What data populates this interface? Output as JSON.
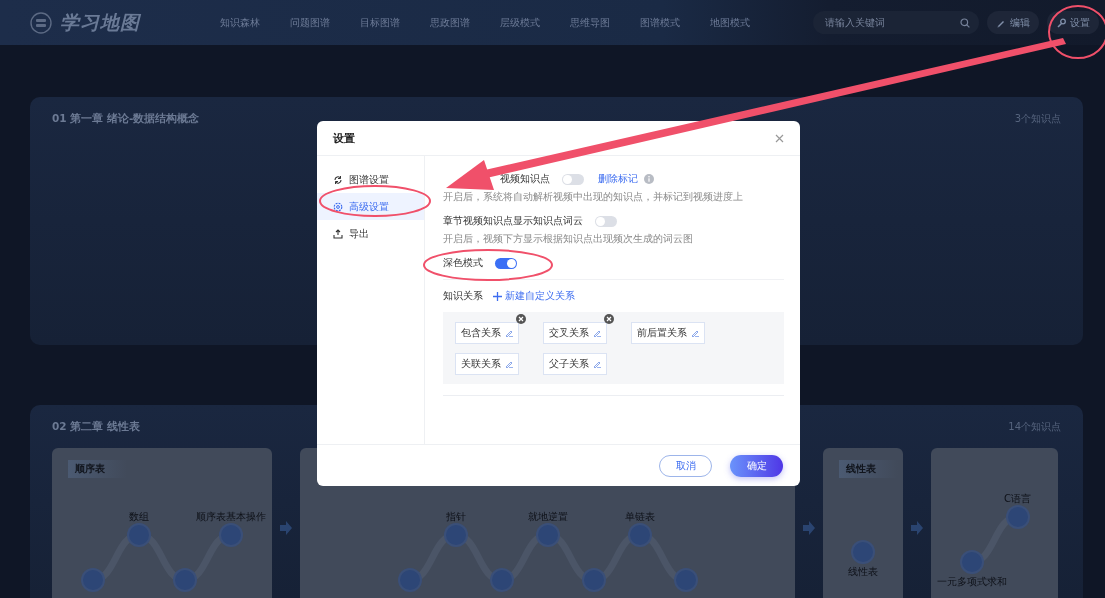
{
  "header": {
    "logo": "学习地图",
    "nav": [
      {
        "label": "知识森林",
        "selected": false
      },
      {
        "label": "问题图谱",
        "selected": false
      },
      {
        "label": "目标图谱",
        "selected": false
      },
      {
        "label": "思政图谱",
        "selected": false
      },
      {
        "label": "层级模式",
        "selected": false
      },
      {
        "label": "思维导图",
        "selected": false
      },
      {
        "label": "图谱模式",
        "selected": false
      },
      {
        "label": "地图模式",
        "selected": false
      }
    ],
    "search": {
      "placeholder": "请输入关键词"
    },
    "buttons": [
      {
        "label": "编辑",
        "kind": "edit"
      },
      {
        "label": "设置",
        "kind": "settings"
      }
    ]
  },
  "sections": [
    {
      "title": "01 第一章 绪论-数据结构概念",
      "count": "3个知识点"
    },
    {
      "title": "02 第二章 线性表",
      "count": "14个知识点",
      "cards": [
        {
          "title": "顺序表",
          "nodes": [
            {
              "kind": "low"
            },
            {
              "kind": "high",
              "label": "数组"
            },
            {
              "kind": "low"
            },
            {
              "kind": "high",
              "label": "顺序表基本操作"
            }
          ]
        },
        {
          "nodes": [
            {
              "kind": "low"
            },
            {
              "kind": "high",
              "label": "指针"
            },
            {
              "kind": "low"
            },
            {
              "kind": "high",
              "label": "就地逆置"
            },
            {
              "kind": "low"
            },
            {
              "kind": "high",
              "label": "单链表"
            },
            {
              "kind": "low"
            }
          ]
        },
        {
          "title": "线性表",
          "nodes": [
            {
              "kind": "mid",
              "label": "线性表"
            }
          ]
        },
        {
          "nodes": [
            {
              "kind": "low",
              "label": "一元多项式求和"
            },
            {
              "kind": "high",
              "label": "C语言"
            }
          ]
        }
      ]
    }
  ],
  "dialog": {
    "title": "设置",
    "menu": [
      {
        "label": "图谱设置",
        "selected": false
      },
      {
        "label": "高级设置",
        "selected": true
      },
      {
        "label": "导出",
        "selected": false
      }
    ],
    "settings": [
      {
        "label": "视频知识点",
        "on": false,
        "link": "删除标记",
        "info": true,
        "hint": "开启后，系统将自动解析视频中出现的知识点，并标记到视频进度上"
      },
      {
        "label": "章节视频知识点显示知识点词云",
        "on": false,
        "hint": "开启后，视频下方显示根据知识点出现频次生成的词云图"
      },
      {
        "label": "深色模式",
        "on": true
      }
    ],
    "relations": {
      "label": "知识关系",
      "add": "新建自定义关系",
      "tags": [
        {
          "label": "包含关系",
          "removable": true
        },
        {
          "label": "交叉关系",
          "removable": true
        },
        {
          "label": "前后置关系",
          "removable": false
        },
        {
          "label": "关联关系",
          "removable": false
        },
        {
          "label": "父子关系",
          "removable": false
        }
      ]
    },
    "buttons": [
      {
        "label": "取消",
        "kind": "secondary"
      },
      {
        "label": "确定",
        "kind": "primary"
      }
    ]
  }
}
